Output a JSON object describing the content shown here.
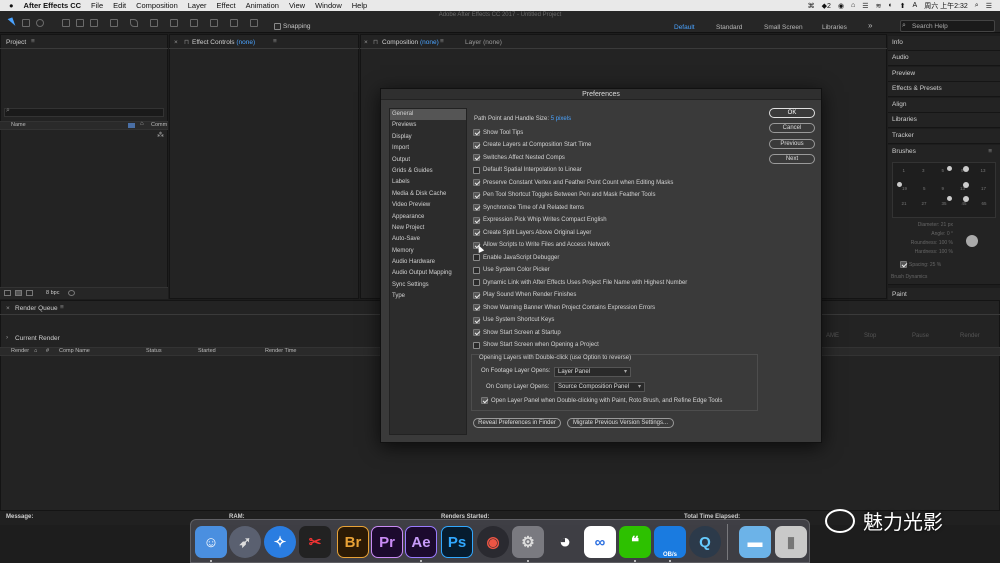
{
  "menubar": {
    "apple": "",
    "items": [
      "After Effects CC",
      "File",
      "Edit",
      "Composition",
      "Layer",
      "Effect",
      "Animation",
      "View",
      "Window",
      "Help"
    ],
    "clock": "周六 上午2:32",
    "status_icons": [
      "⌘",
      "◆2",
      "◉",
      "⌂",
      "☰",
      "≋",
      "◐",
      "⬆",
      "A"
    ]
  },
  "window_title": "Adobe After Effects CC 2017 - Untitled Project",
  "toolbar": {
    "snapping_label": "Snapping",
    "workspaces": [
      "Default",
      "Standard",
      "Small Screen",
      "Libraries"
    ],
    "more": "»",
    "search_placeholder": "Search Help"
  },
  "project_panel": {
    "title": "Project",
    "col_name": "Name",
    "col_comment": "Comm",
    "bpc": "8 bpc"
  },
  "effect_controls": {
    "title": "Effect Controls",
    "title_value": "(none)"
  },
  "composition_panel": {
    "title": "Composition",
    "title_value": "(none)",
    "layer_tab": "Layer (none)"
  },
  "right_panels": [
    "Info",
    "Audio",
    "Preview",
    "Effects & Presets",
    "Align",
    "Libraries",
    "Tracker",
    "Brushes"
  ],
  "brushes": {
    "sizes_row1": [
      "1",
      "3",
      "5",
      "9",
      "13"
    ],
    "sizes_row2": [
      "19",
      "5",
      "9",
      "13",
      "17"
    ],
    "sizes_row3": [
      "21",
      "27",
      "35",
      "45",
      "65"
    ],
    "diameter": "Diameter: 21 px",
    "angle": "Angle: 0 °",
    "roundness": "Roundness: 100 %",
    "hardness": "Hardness: 100 %",
    "spacing": "Spacing: 25 %",
    "dynamics": "Brush Dynamics",
    "paint": "Paint"
  },
  "render_queue": {
    "title": "Render Queue",
    "current_render": "Current Render",
    "cols": [
      "Render",
      "#",
      "Comp Name",
      "Status",
      "Started",
      "Render Time"
    ],
    "buttons": [
      "AME",
      "Stop",
      "Pause",
      "Render"
    ]
  },
  "status": {
    "message": "Message:",
    "ram": "RAM:",
    "renders_started": "Renders Started:",
    "total_time": "Total Time Elapsed:"
  },
  "dialog": {
    "title": "Preferences",
    "categories": [
      "General",
      "Previews",
      "Display",
      "Import",
      "Output",
      "Grids & Guides",
      "Labels",
      "Media & Disk Cache",
      "Video Preview",
      "Appearance",
      "New Project",
      "Auto-Save",
      "Memory",
      "Audio Hardware",
      "Audio Output Mapping",
      "Sync Settings",
      "Type"
    ],
    "selected_category": "General",
    "path_point_label": "Path Point and Handle Size:",
    "path_point_value": "5 pixels",
    "options": [
      {
        "label": "Show Tool Tips",
        "checked": true
      },
      {
        "label": "Create Layers at Composition Start Time",
        "checked": true
      },
      {
        "label": "Switches Affect Nested Comps",
        "checked": true
      },
      {
        "label": "Default Spatial Interpolation to Linear",
        "checked": false
      },
      {
        "label": "Preserve Constant Vertex and Feather Point Count when Editing Masks",
        "checked": true
      },
      {
        "label": "Pen Tool Shortcut Toggles Between Pen and Mask Feather Tools",
        "checked": true
      },
      {
        "label": "Synchronize Time of All Related Items",
        "checked": true
      },
      {
        "label": "Expression Pick Whip Writes Compact English",
        "checked": true
      },
      {
        "label": "Create Split Layers Above Original Layer",
        "checked": true
      },
      {
        "label": "Allow Scripts to Write Files and Access Network",
        "checked": true
      },
      {
        "label": "Enable JavaScript Debugger",
        "checked": false
      },
      {
        "label": "Use System Color Picker",
        "checked": false
      },
      {
        "label": "Dynamic Link with After Effects Uses Project File Name with Highest Number",
        "checked": false
      },
      {
        "label": "Play Sound When Render Finishes",
        "checked": true
      },
      {
        "label": "Show Warning Banner When Project Contains Expression Errors",
        "checked": true
      },
      {
        "label": "Use System Shortcut Keys",
        "checked": true
      },
      {
        "label": "Show Start Screen at Startup",
        "checked": true
      },
      {
        "label": "Show Start Screen when Opening a Project",
        "checked": false
      }
    ],
    "group_title": "Opening Layers with Double-click (use Option to reverse)",
    "footage_label": "On Footage Layer Opens:",
    "footage_value": "Layer Panel",
    "comp_label": "On Comp Layer Opens:",
    "comp_value": "Source Composition Panel",
    "open_layer_panel": "Open Layer Panel when Double-clicking with Paint, Roto Brush, and Refine Edge Tools",
    "buttons": {
      "ok": "OK",
      "cancel": "Cancel",
      "previous": "Previous",
      "next": "Next"
    },
    "reveal": "Reveal Preferences in Finder",
    "migrate": "Migrate Previous Version Settings..."
  },
  "dock": {
    "apps": [
      "Finder",
      "Launchpad",
      "Safari",
      "Final Cut Pro",
      "Br",
      "Pr",
      "Ae",
      "Ps",
      "DaVinci Resolve",
      "System Preferences",
      "QQ",
      "Baidu",
      "WeChat",
      "Xcode",
      "QuickTime",
      "Folder",
      "Trash"
    ],
    "xcode_badge": "OB/s"
  },
  "watermark": "魅力光影"
}
